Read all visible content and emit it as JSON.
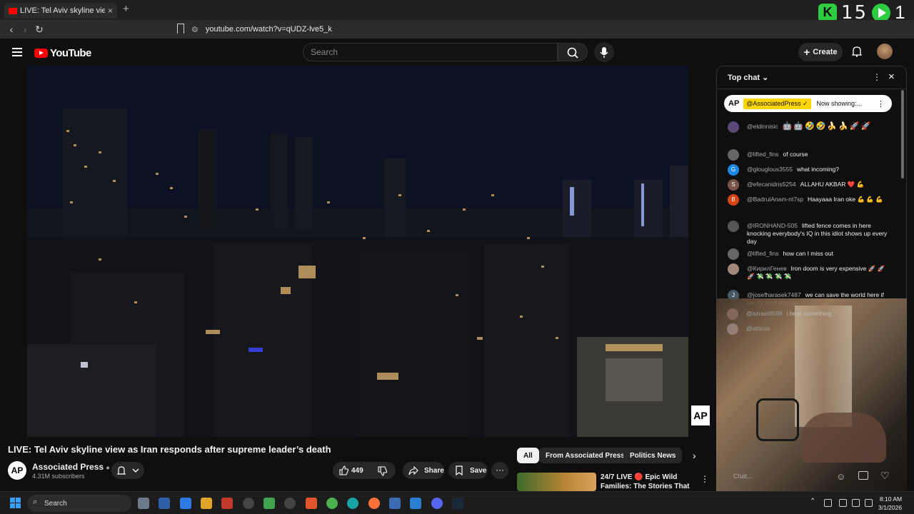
{
  "browser": {
    "tab_title": "LIVE: Tel Aviv skyline view as I",
    "new_tab": "+",
    "url": "youtube.com/watch?v=qUDZ-lve5_k",
    "overlay_count_a": "15",
    "overlay_count_b": "1"
  },
  "youtube": {
    "logo_text": "YouTube",
    "search_placeholder": "Search",
    "create_label": "Create"
  },
  "video": {
    "title": "LIVE: Tel Aviv skyline view as Iran responds after supreme leader’s death",
    "watermark": "AP",
    "channel_avatar": "AP",
    "channel_name": "Associated Press",
    "subscribers": "4.31M subscribers",
    "like_count": "449",
    "share_label": "Share",
    "save_label": "Save",
    "more": "···"
  },
  "recommendations": {
    "chips": [
      "All",
      "From Associated Press",
      "Politics News"
    ],
    "item_title": "24/7 LIVE 🔴 Epic Wild Families: The Stories That ..."
  },
  "chat": {
    "header": "Top chat",
    "pinned_logo": "AP",
    "pinned_channel": "@AssociatedPress ✓",
    "pinned_text": "Now showing:...",
    "input_placeholder": "Chat...",
    "messages": [
      {
        "user": "@eldinnisic",
        "text": "",
        "avatar": "",
        "emoji": "🤖🤖🤣🤣🍌🍌🚀🚀"
      },
      {
        "user": "@lifted_fins",
        "text": "of course",
        "avatar": ""
      },
      {
        "user": "@glouglous3555",
        "text": "what incoming?",
        "avatar": "G"
      },
      {
        "user": "@efecanidris5254",
        "text": "ALLAHU AKBAR ❤️ 💪",
        "avatar": "S"
      },
      {
        "user": "@BadrulAnam-nt7sp",
        "text": "Haayaaa Iran oke 💪 💪 💪",
        "avatar": "B"
      },
      {
        "user": "@IRONHAND-505",
        "text": "lifted fence comes in here knocking everybody's IQ in this idiot shows up every day",
        "avatar": ""
      },
      {
        "user": "@lifted_fins",
        "text": "how can I miss out",
        "avatar": ""
      },
      {
        "user": "@КирилГенев",
        "text": "Iron doom is very expensive 🚀 🚀 🚀 💸 💸 💸 💸",
        "avatar": ""
      },
      {
        "user": "@josefharasek7487",
        "text": "we can save the world here if we try hard enough",
        "avatar": "J"
      },
      {
        "user": "@azrael8598",
        "text": "i hear something",
        "avatar": ""
      },
      {
        "user": "@atticus",
        "text": "",
        "avatar": ""
      }
    ]
  },
  "taskbar": {
    "search_label": "Search",
    "time": "8:10 AM",
    "date": "3/1/2026"
  },
  "colors": {
    "background": "#0f0f0f",
    "yt_red": "#ff0000",
    "pinned_tag": "#ffd600",
    "overlay_green": "#2ecc40"
  }
}
